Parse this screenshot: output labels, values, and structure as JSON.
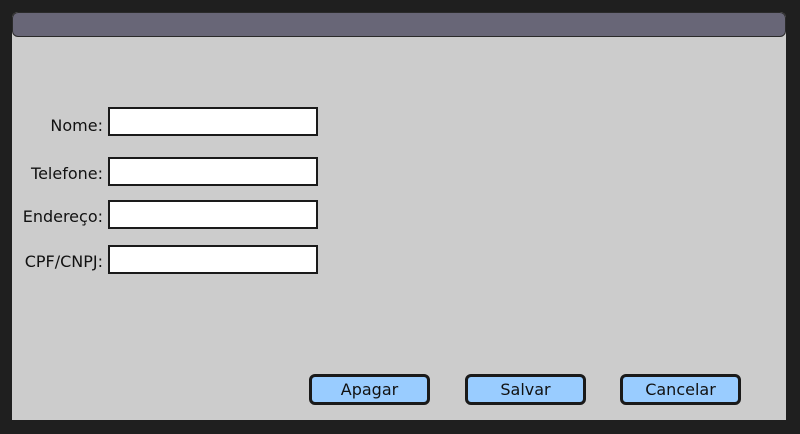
{
  "window": {
    "title": ""
  },
  "form": {
    "fields": [
      {
        "label": "Nome:",
        "value": "",
        "placeholder": ""
      },
      {
        "label": "Telefone:",
        "value": "",
        "placeholder": ""
      },
      {
        "label": "Endereço:",
        "value": "",
        "placeholder": ""
      },
      {
        "label": "CPF/CNPJ:",
        "value": "",
        "placeholder": ""
      }
    ]
  },
  "buttons": {
    "clear_label": "Apagar",
    "save_label": "Salvar",
    "cancel_label": "Cancelar"
  },
  "colors": {
    "titlebar": "#686677",
    "window_background": "#cccccc",
    "button_fill": "#99ccff",
    "outer_background": "#1f1f1f"
  }
}
